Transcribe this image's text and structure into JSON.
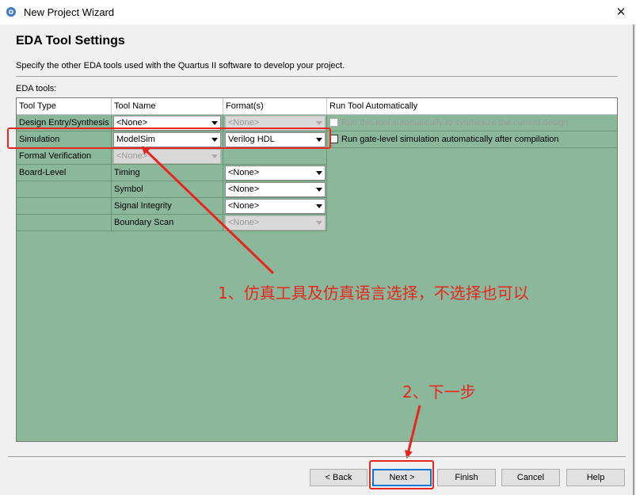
{
  "window": {
    "title": "New Project Wizard",
    "close_glyph": "✕"
  },
  "page": {
    "title": "EDA Tool Settings",
    "description": "Specify the other EDA tools used with the Quartus II software to develop your project.",
    "tools_label": "EDA tools:"
  },
  "table": {
    "headers": [
      "Tool Type",
      "Tool Name",
      "Format(s)",
      "Run Tool Automatically"
    ],
    "rows": [
      {
        "type": "Design Entry/Synthesis",
        "tool": "<None>",
        "tool_enabled": true,
        "format": "<None>",
        "format_enabled": false,
        "run_label": "Run this tool automatically to synthesize the current design",
        "run_enabled": false
      },
      {
        "type": "Simulation",
        "tool": "ModelSim",
        "tool_enabled": true,
        "format": "Verilog HDL",
        "format_enabled": true,
        "run_label": "Run gate-level simulation automatically after compilation",
        "run_enabled": true
      },
      {
        "type": "Formal Verification",
        "tool": "<None>",
        "tool_enabled": false
      },
      {
        "type": "Board-Level",
        "tool": "Timing",
        "format": "<None>",
        "format_enabled": true
      },
      {
        "type": "",
        "tool": "Symbol",
        "format": "<None>",
        "format_enabled": true
      },
      {
        "type": "",
        "tool": "Signal Integrity",
        "format": "<None>",
        "format_enabled": true
      },
      {
        "type": "",
        "tool": "Boundary Scan",
        "format": "<None>",
        "format_enabled": false
      }
    ]
  },
  "buttons": {
    "back": "< Back",
    "next": "Next >",
    "finish": "Finish",
    "cancel": "Cancel",
    "help": "Help"
  },
  "annotations": {
    "step1": "1、仿真工具及仿真语言选择，不选择也可以",
    "step2": "2、下一步"
  },
  "colors": {
    "grid_bg": "#8bb89a",
    "annotation_red": "#e8261f",
    "focus_blue": "#0078d7"
  }
}
